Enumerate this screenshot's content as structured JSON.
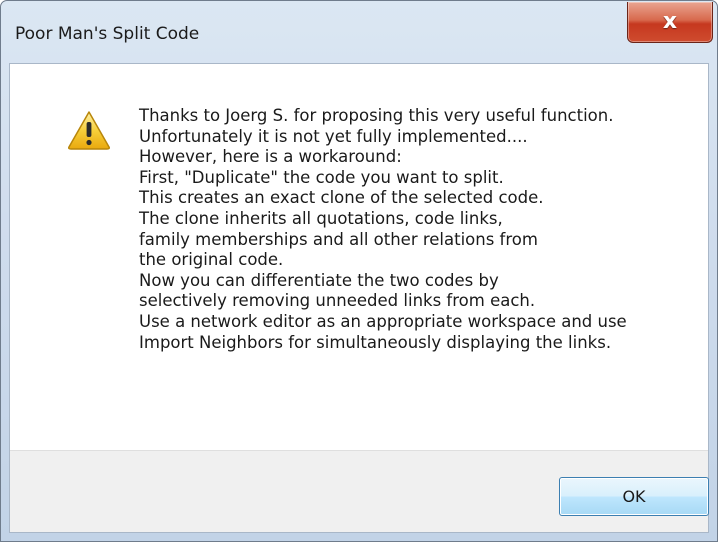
{
  "window": {
    "title": "Poor Man's Split Code",
    "close_glyph": "x"
  },
  "dialog": {
    "icon": "warning-icon",
    "message_lines": [
      "Thanks to Joerg S. for proposing this very useful function.",
      "Unfortunately it is not yet fully implemented....",
      "However, here is a workaround:",
      "First, \"Duplicate\" the code you want to split.",
      "This creates an exact clone of the selected code.",
      "The clone inherits all quotations, code links,",
      "family memberships and all other relations from",
      "the original code.",
      "Now you can differentiate the two codes by",
      "selectively removing unneeded links from each.",
      "Use a network editor as an appropriate workspace and use",
      "Import Neighbors for simultaneously displaying the links."
    ],
    "ok_label": "OK"
  },
  "colors": {
    "warning_fill": "#f5c425",
    "warning_stroke": "#b8860b",
    "close_red": "#c6381f",
    "ok_border": "#3c7fb1"
  }
}
